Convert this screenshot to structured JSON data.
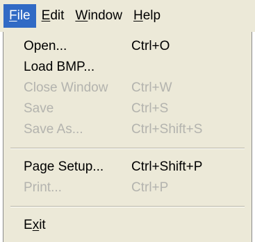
{
  "menubar": {
    "items": [
      {
        "prefix": "",
        "mnemonic": "F",
        "rest": "ile",
        "active": true
      },
      {
        "prefix": "",
        "mnemonic": "E",
        "rest": "dit",
        "active": false
      },
      {
        "prefix": "",
        "mnemonic": "W",
        "rest": "indow",
        "active": false
      },
      {
        "prefix": "",
        "mnemonic": "H",
        "rest": "elp",
        "active": false
      }
    ]
  },
  "file_menu": {
    "items": [
      {
        "label": "Open...",
        "shortcut": "Ctrl+O",
        "enabled": true
      },
      {
        "label": "Load BMP...",
        "shortcut": "",
        "enabled": true
      },
      {
        "label": "Close Window",
        "shortcut": "Ctrl+W",
        "enabled": false
      },
      {
        "label": "Save",
        "shortcut": "Ctrl+S",
        "enabled": false
      },
      {
        "label": "Save As...",
        "shortcut": "Ctrl+Shift+S",
        "enabled": false
      },
      {
        "label": "Page Setup...",
        "shortcut": "Ctrl+Shift+P",
        "enabled": true
      },
      {
        "label": "Print...",
        "shortcut": "Ctrl+P",
        "enabled": false
      },
      {
        "label_prefix": "E",
        "label_mnemonic": "x",
        "label_rest": "it",
        "shortcut": "",
        "enabled": true
      }
    ]
  },
  "colors": {
    "menu_bg": "#ece9d8",
    "highlight": "#316ac5",
    "disabled_text": "#b3b3ae"
  }
}
